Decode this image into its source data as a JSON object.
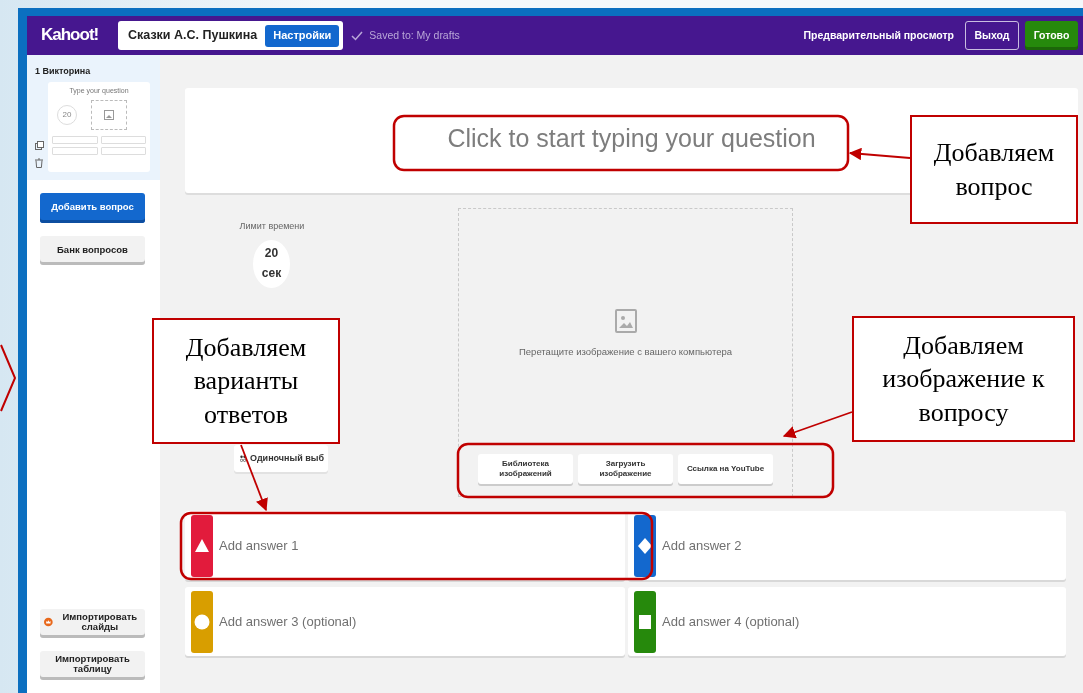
{
  "header": {
    "logo": "Kahoot!",
    "title": "Сказки А.С. Пушкина",
    "settings_button": "Настройки",
    "saved_status": "Saved to: My drafts",
    "preview": "Предварительный просмотр",
    "exit_button": "Выход",
    "done_button": "Готово"
  },
  "sidebar": {
    "slides": [
      {
        "number": "1",
        "type": "Викторина",
        "thumbnail_question": "Type your question",
        "thumbnail_time": "20",
        "selected": true
      }
    ],
    "add_question": "Добавить вопрос",
    "question_bank": "Банк вопросов",
    "import_slides": "Импортировать слайды",
    "import_table": "Импортировать таблицу"
  },
  "editor": {
    "question_placeholder": "Click to start typing your question",
    "time_limit_label": "Лимит времени",
    "time_value": "20",
    "time_unit": "сек",
    "question_type": "Одиночный выб",
    "media_hint": "Перетащите изображение с вашего компьютера",
    "media_buttons": [
      "Библиотека изображений",
      "Загрузить изображение",
      "Ссылка на YouTube"
    ],
    "answers": [
      {
        "placeholder": "Add answer 1",
        "kind": "triangle",
        "color": "#e21b3c"
      },
      {
        "placeholder": "Add answer 2",
        "kind": "diamond",
        "color": "#1368ce"
      },
      {
        "placeholder": "Add answer 3 (optional)",
        "kind": "circle",
        "color": "#d89e00"
      },
      {
        "placeholder": "Add answer 4 (optional)",
        "kind": "square",
        "color": "#26890c"
      }
    ]
  },
  "annotations": [
    {
      "text": "Добавляем вопрос"
    },
    {
      "text": "Добавляем варианты ответов"
    },
    {
      "text": "Добавляем изображение к вопросу"
    }
  ]
}
